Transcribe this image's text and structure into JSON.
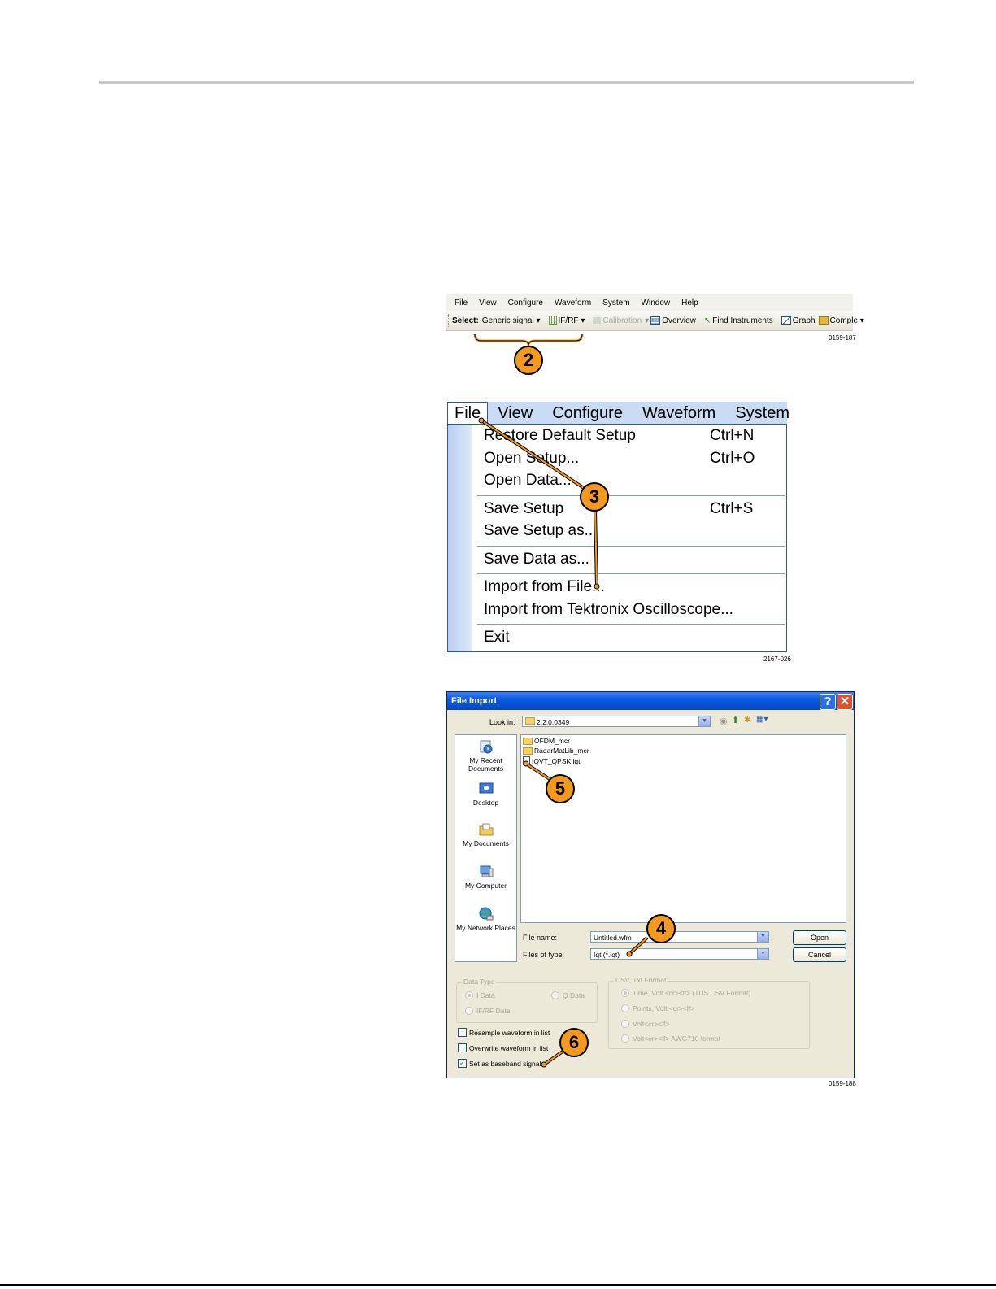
{
  "figure1": {
    "menu": [
      "File",
      "View",
      "Configure",
      "Waveform",
      "System",
      "Window",
      "Help"
    ],
    "toolbar": {
      "select_label": "Select:",
      "generic_signal": "Generic signal",
      "ifrf": "IF/RF",
      "calibration": "Calibration",
      "overview": "Overview",
      "find_instruments": "Find Instruments",
      "graph": "Graph",
      "compile": "Comple"
    },
    "figure_id": "0159-187",
    "callout": "2"
  },
  "figure2": {
    "menu": [
      "File",
      "View",
      "Configure",
      "Waveform",
      "System"
    ],
    "items": [
      {
        "label": "Restore Default Setup",
        "shortcut": "Ctrl+N"
      },
      {
        "label": "Open Setup...",
        "shortcut": "Ctrl+O"
      },
      {
        "label": "Open Data...",
        "shortcut": ""
      },
      {
        "label": "Save Setup",
        "shortcut": "Ctrl+S"
      },
      {
        "label": "Save Setup as...",
        "shortcut": ""
      },
      {
        "label": "Save Data as...",
        "shortcut": ""
      },
      {
        "label": "Import from File...",
        "shortcut": ""
      },
      {
        "label": "Import from Tektronix Oscilloscope...",
        "shortcut": ""
      },
      {
        "label": "Exit",
        "shortcut": ""
      }
    ],
    "figure_id": "2167-026",
    "callout": "3"
  },
  "figure3": {
    "title": "File Import",
    "help_glyph": "?",
    "close_glyph": "✕",
    "look_in_label": "Look in:",
    "look_in_value": "2.2.0.0349",
    "places": [
      "My Recent Documents",
      "Desktop",
      "My Documents",
      "My Computer",
      "My Network Places"
    ],
    "files": [
      "OFDM_mcr",
      "RadarMatLib_mcr",
      "IQVT_QPSK.iqt"
    ],
    "file_name_label": "File name:",
    "file_name_value": "Untitled.wfm",
    "file_type_label": "Files of type:",
    "file_type_value": "Iqt (*.iqt)",
    "open_button": "Open",
    "cancel_button": "Cancel",
    "data_type": {
      "title": "Data Type",
      "options": [
        "I Data",
        "Q Data",
        "IF/RF Data"
      ]
    },
    "csv_format": {
      "title": "CSV, Txt Format",
      "options": [
        "Time, Volt <cr><lf> (TDS CSV Format)",
        "Points, Volt <cr><lf>",
        "Volt<cr><lf>",
        "Volt<cr><lf> AWG710 format"
      ]
    },
    "checks": [
      {
        "label": "Resample waveform in list",
        "checked": false
      },
      {
        "label": "Overwrite waveform in list",
        "checked": false
      },
      {
        "label": "Set as baseband signal",
        "checked": true
      }
    ],
    "figure_id": "0159-188",
    "callouts": [
      "4",
      "5",
      "6"
    ]
  }
}
